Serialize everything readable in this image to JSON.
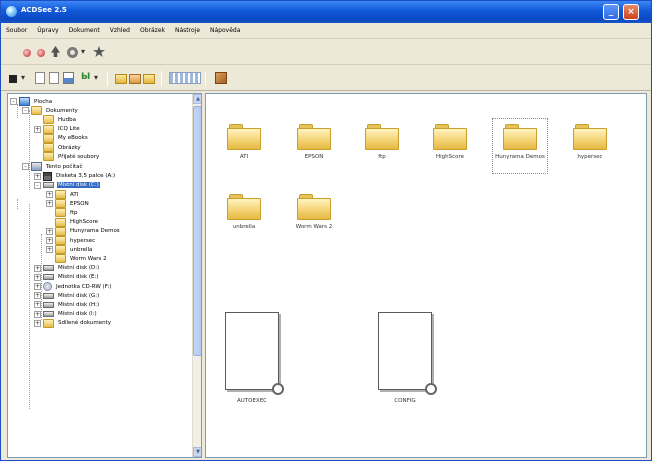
{
  "window": {
    "title": "ACDSee  2.5",
    "minimize_glyph": "_",
    "close_glyph": "×"
  },
  "menubar": {
    "items": [
      "Soubor",
      "Úpravy",
      "Dokument",
      "Vzhled",
      "Obrázek",
      "Nástroje",
      "Nápověda"
    ]
  },
  "toolbar": {
    "icons": [
      "back-icon",
      "forward-icon",
      "up-icon",
      "settings-icon",
      "favorites-icon"
    ],
    "dropdown_glyph": "▾",
    "green_glyph": "Ы"
  },
  "tree": {
    "items": [
      {
        "label": "Plocha",
        "level": 0,
        "icon": "desktop",
        "expander": "-"
      },
      {
        "label": "Dokumenty",
        "level": 1,
        "icon": "folder",
        "expander": "-"
      },
      {
        "label": "Hudba",
        "level": 2,
        "icon": "folder",
        "expander": ""
      },
      {
        "label": "ICQ Lite",
        "level": 2,
        "icon": "folder",
        "expander": "+"
      },
      {
        "label": "My eBooks",
        "level": 2,
        "icon": "folder",
        "expander": ""
      },
      {
        "label": "Obrázky",
        "level": 2,
        "icon": "folder",
        "expander": ""
      },
      {
        "label": "Přijaté soubory",
        "level": 2,
        "icon": "folder",
        "expander": ""
      },
      {
        "label": "Tento počítač",
        "level": 1,
        "icon": "pc",
        "expander": "-"
      },
      {
        "label": "Disketa 3,5 palce (A:)",
        "level": 2,
        "icon": "floppy",
        "expander": "+"
      },
      {
        "label": "Místní disk (C:)",
        "level": 2,
        "icon": "disk",
        "expander": "-",
        "selected": true
      },
      {
        "label": "ATI",
        "level": 3,
        "icon": "folder",
        "expander": "+"
      },
      {
        "label": "EPSON",
        "level": 3,
        "icon": "folder",
        "expander": "+"
      },
      {
        "label": "ftp",
        "level": 3,
        "icon": "folder",
        "expander": ""
      },
      {
        "label": "HighScore",
        "level": 3,
        "icon": "folder",
        "expander": ""
      },
      {
        "label": "Hunyrama Demos",
        "level": 3,
        "icon": "folder",
        "expander": "+"
      },
      {
        "label": "hypersec",
        "level": 3,
        "icon": "folder",
        "expander": "+"
      },
      {
        "label": "unbrella",
        "level": 3,
        "icon": "folder",
        "expander": "+"
      },
      {
        "label": "Worm Wars 2",
        "level": 3,
        "icon": "folder",
        "expander": ""
      },
      {
        "label": "Místní disk (D:)",
        "level": 2,
        "icon": "disk",
        "expander": "+"
      },
      {
        "label": "Místní disk (E:)",
        "level": 2,
        "icon": "disk",
        "expander": "+"
      },
      {
        "label": "Jednotka CD-RW (F:)",
        "level": 2,
        "icon": "cd",
        "expander": "+"
      },
      {
        "label": "Místní disk (G:)",
        "level": 2,
        "icon": "disk",
        "expander": "+"
      },
      {
        "label": "Místní disk (H:)",
        "level": 2,
        "icon": "disk",
        "expander": "+"
      },
      {
        "label": "Místní disk (I:)",
        "level": 2,
        "icon": "disk",
        "expander": "+"
      },
      {
        "label": "Sdílené dokumenty",
        "level": 2,
        "icon": "folder",
        "expander": "+"
      }
    ],
    "scroll_up_glyph": "▲",
    "scroll_down_glyph": "▼"
  },
  "content": {
    "folders": [
      {
        "label": "ATI"
      },
      {
        "label": "EPSON"
      },
      {
        "label": "ftp"
      },
      {
        "label": "HighScore"
      },
      {
        "label": "Hunyrama Demos",
        "selected": true
      },
      {
        "label": "hypersec"
      },
      {
        "label": "unbrella"
      },
      {
        "label": "Worm Wars 2"
      }
    ],
    "files": [
      {
        "label": "AUTOEXEC"
      },
      {
        "label": "CONFIG"
      }
    ]
  }
}
